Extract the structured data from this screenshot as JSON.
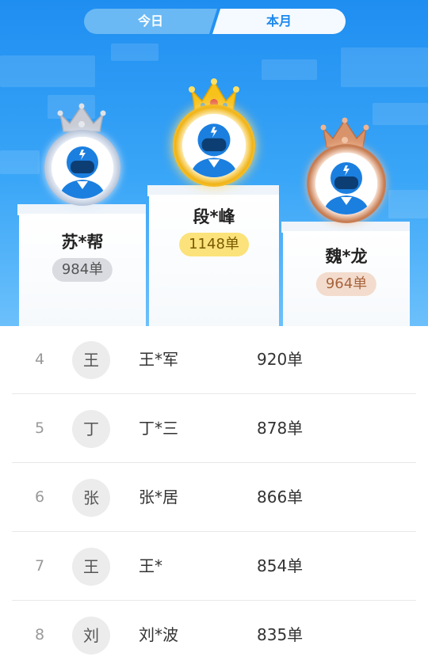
{
  "tabs": [
    {
      "label": "今日",
      "active": false
    },
    {
      "label": "本月",
      "active": true
    }
  ],
  "podium": {
    "first": {
      "rank": 1,
      "name": "段*峰",
      "score": "1148单",
      "crown": "gold-crown-icon"
    },
    "second": {
      "rank": 2,
      "name": "苏*帮",
      "score": "984单",
      "crown": "silver-crown-icon"
    },
    "third": {
      "rank": 3,
      "name": "魏*龙",
      "score": "964单",
      "crown": "bronze-crown-icon"
    }
  },
  "ranking": [
    {
      "rank": "4",
      "avatar": "王",
      "name": "王*军",
      "count": "920单"
    },
    {
      "rank": "5",
      "avatar": "丁",
      "name": "丁*三",
      "count": "878单"
    },
    {
      "rank": "6",
      "avatar": "张",
      "name": "张*居",
      "count": "866单"
    },
    {
      "rank": "7",
      "avatar": "王",
      "name": "王*",
      "count": "854单"
    },
    {
      "rank": "8",
      "avatar": "刘",
      "name": "刘*波",
      "count": "835单"
    }
  ],
  "colors": {
    "accent_blue": "#1d88ee",
    "gold": "#f7c21a",
    "silver": "#b8bcc6",
    "bronze": "#d9936a"
  }
}
